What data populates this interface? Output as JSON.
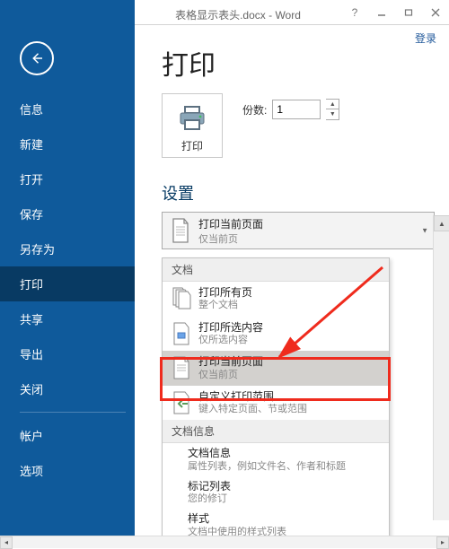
{
  "titlebar": {
    "doc": "表格显示表头.docx - Word",
    "login": "登录"
  },
  "sidebar": {
    "items": [
      "信息",
      "新建",
      "打开",
      "保存",
      "另存为",
      "打印",
      "共享",
      "导出",
      "关闭"
    ],
    "bottom": [
      "帐户",
      "选项"
    ],
    "active_index": 5
  },
  "page": {
    "title": "打印",
    "print_btn": "打印",
    "copies_label": "份数:",
    "copies_value": "1",
    "settings_heading": "设置"
  },
  "dropdown": {
    "title": "打印当前页面",
    "sub": "仅当前页"
  },
  "flyout": {
    "section1": "文档",
    "items": [
      {
        "title": "打印所有页",
        "sub": "整个文档"
      },
      {
        "title": "打印所选内容",
        "sub": "仅所选内容"
      },
      {
        "title": "打印当前页面",
        "sub": "仅当前页",
        "selected": true
      },
      {
        "title": "自定义打印范围",
        "sub": "键入特定页面、节或范围"
      }
    ],
    "section2": "文档信息",
    "info": {
      "title": "文档信息",
      "sub": "属性列表，例如文件名、作者和标题"
    },
    "extra1": {
      "title": "标记列表",
      "sub": "您的修订"
    },
    "extra2": {
      "title": "样式",
      "sub": "文档中使用的样式列表"
    }
  }
}
